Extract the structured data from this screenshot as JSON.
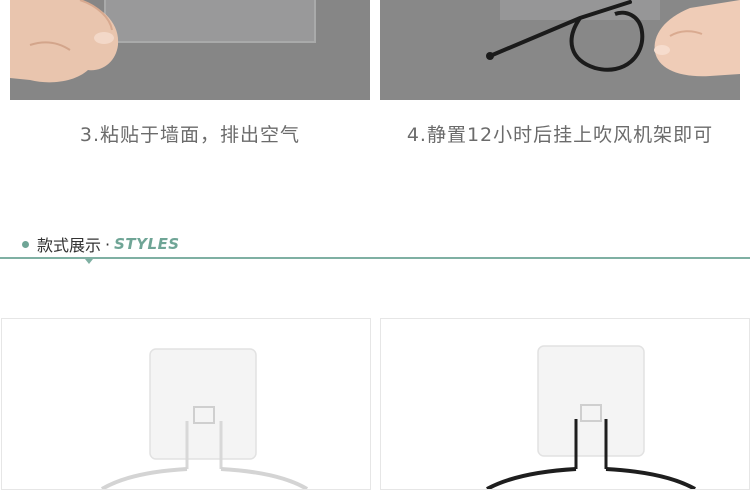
{
  "steps": [
    {
      "caption": "3.粘贴于墙面，排出空气",
      "image": "hand-pressing-clear-adhesive-hook-photo"
    },
    {
      "caption": "4.静置12小时后挂上吹风机架即可",
      "image": "hand-holding-black-wire-dryer-holder-photo"
    }
  ],
  "section": {
    "title_cn": "款式展示",
    "separator": "·",
    "title_en": "STYLES",
    "accent_color": "#6fa596"
  },
  "products": [
    {
      "style": "white",
      "image": "white-hair-dryer-holder-product"
    },
    {
      "style": "black",
      "image": "black-hair-dryer-holder-product"
    }
  ]
}
